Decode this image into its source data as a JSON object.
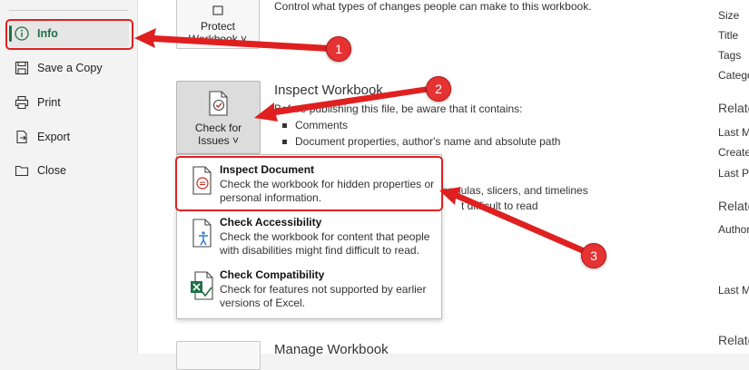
{
  "sidebar": {
    "items": [
      {
        "label": "Info",
        "icon": "info-icon",
        "active": true
      },
      {
        "label": "Save a Copy",
        "icon": "save-copy-icon"
      },
      {
        "label": "Print",
        "icon": "printer-icon"
      },
      {
        "label": "Export",
        "icon": "export-icon"
      },
      {
        "label": "Close",
        "icon": "folder-icon"
      }
    ]
  },
  "protect": {
    "button_line1": "Protect",
    "button_line2": "Workbook ˅",
    "description": "Control what types of changes people can make to this workbook."
  },
  "inspect": {
    "title": "Inspect Workbook",
    "button_line1": "Check for",
    "button_line2": "Issues ˅",
    "intro": "Before publishing this file, be aware that it contains:",
    "bullets": [
      "Comments",
      "Document properties, author's name and absolute path"
    ],
    "partial_line1": "ormulas, slicers, and timelines",
    "partial_line2": "t difficult to read"
  },
  "dropdown": {
    "items": [
      {
        "title": "Inspect Document",
        "description": "Check the workbook for hidden properties or personal information.",
        "icon": "inspect-document-icon"
      },
      {
        "title": "Check Accessibility",
        "description": "Check the workbook for content that people with disabilities might find difficult to read.",
        "icon": "accessibility-icon"
      },
      {
        "title": "Check Compatibility",
        "description": "Check for features not supported by earlier versions of Excel.",
        "icon": "compatibility-icon"
      }
    ]
  },
  "manage": {
    "title": "Manage Workbook"
  },
  "properties": {
    "labels": [
      "Size",
      "Title",
      "Tags",
      "Catego"
    ],
    "related_dates_header": "Relate",
    "date_labels": [
      "Last M",
      "Created",
      "Last Pr"
    ],
    "related_people_header": "Relate",
    "author_label": "Author",
    "last_modified_by": "Last M",
    "related_docs_header": "Relate"
  },
  "annotations": {
    "badges": [
      "1",
      "2",
      "3"
    ],
    "accent_color": "#e53333"
  },
  "colors": {
    "excel_green": "#1e7145",
    "sidebar_bg": "#f3f3f3"
  }
}
